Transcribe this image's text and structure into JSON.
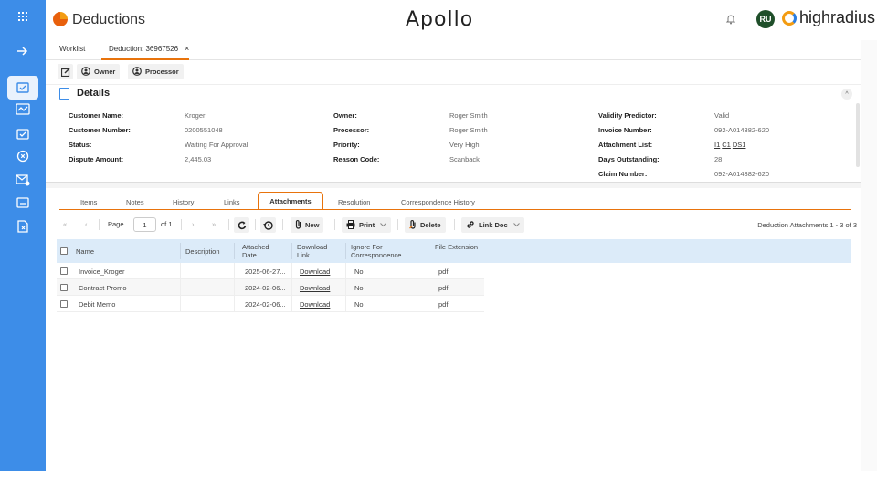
{
  "rail": {
    "items": [
      "apps-grid",
      "collapse-arrow",
      "worklist",
      "analytics",
      "tasks",
      "disputes",
      "mail",
      "reports",
      "documents"
    ]
  },
  "header": {
    "app_title": "Deductions",
    "brand_center": "Apollo",
    "avatar_initials": "RU",
    "company": "highradius"
  },
  "tabs": [
    {
      "label": "Worklist"
    },
    {
      "label": "Deduction: 36967526",
      "close": "×"
    }
  ],
  "toolbar": {
    "owner_label": "Owner",
    "processor_label": "Processor"
  },
  "details": {
    "title": "Details",
    "collapse_glyph": "^",
    "fields_col1": [
      {
        "label": "Customer Name:",
        "value": "Kroger"
      },
      {
        "label": "Customer Number:",
        "value": "0200551048"
      },
      {
        "label": "Status:",
        "value": "Waiting For Approval"
      },
      {
        "label": "Dispute Amount:",
        "value": "2,445.03"
      }
    ],
    "fields_col2": [
      {
        "label": "Owner:",
        "value": "Roger Smith"
      },
      {
        "label": "Processor:",
        "value": "Roger Smith"
      },
      {
        "label": "Priority:",
        "value": "Very High"
      },
      {
        "label": "Reason Code:",
        "value": "Scanback"
      }
    ],
    "fields_col3": [
      {
        "label": "Validity Predictor:",
        "value": "Valid"
      },
      {
        "label": "Invoice Number:",
        "value": "092-A014382-620"
      },
      {
        "label": "Attachment List:",
        "links": [
          "I1",
          "C1",
          "DS1"
        ]
      },
      {
        "label": "Days Outstanding:",
        "value": "28"
      },
      {
        "label": "Claim Number:",
        "value": "092-A014382-620"
      }
    ]
  },
  "subtabs": [
    "Items",
    "Notes",
    "History",
    "Links",
    "Attachments",
    "Resolution",
    "Correspondence History"
  ],
  "active_subtab": "Attachments",
  "pager": {
    "first": "«",
    "prev": "‹",
    "page_label": "Page",
    "page_value": "1",
    "of_label": "of 1",
    "next": "›",
    "last": "»",
    "new_label": "New",
    "print_label": "Print",
    "delete_label": "Delete",
    "linkdoc_label": "Link Doc",
    "info": "Deduction Attachments 1 - 3 of 3"
  },
  "grid": {
    "columns": {
      "name": "Name",
      "description": "Description",
      "attached_date": "Attached Date",
      "download_link": "Download Link",
      "ignore": "Ignore For Correspondence",
      "file_ext": "File Extension"
    },
    "rows": [
      {
        "name": "Invoice_Kroger",
        "description": "",
        "attached_date": "2025-06-27...",
        "download_link": "Download",
        "ignore": "No",
        "file_ext": "pdf"
      },
      {
        "name": "Contract Promo",
        "description": "",
        "attached_date": "2024-02-06...",
        "download_link": "Download",
        "ignore": "No",
        "file_ext": "pdf"
      },
      {
        "name": "Debit Memo",
        "description": "",
        "attached_date": "2024-02-06...",
        "download_link": "Download",
        "ignore": "No",
        "file_ext": "pdf"
      }
    ]
  },
  "colors": {
    "rail": "#3d8de8",
    "accent": "#e8730c",
    "grid_header": "#dcebf9"
  }
}
